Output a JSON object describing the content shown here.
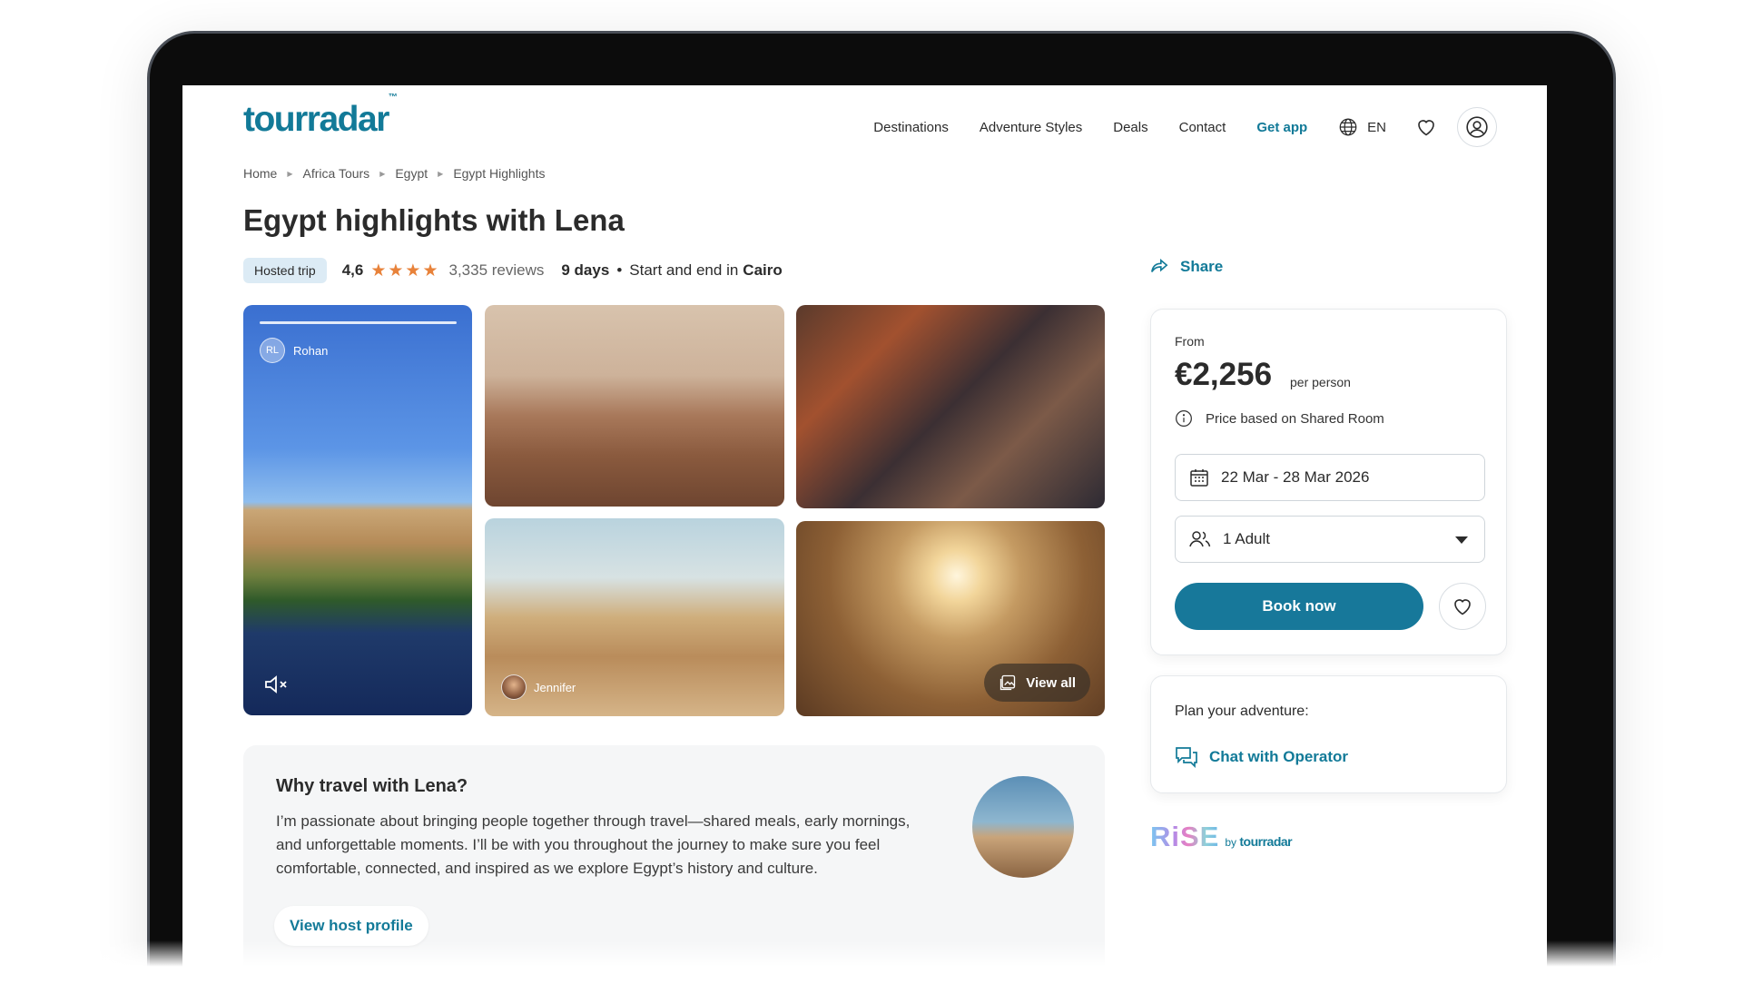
{
  "header": {
    "logo": "tourradar",
    "logo_tm": "™",
    "nav": [
      "Destinations",
      "Adventure Styles",
      "Deals",
      "Contact"
    ],
    "get_app": "Get app",
    "language": "EN"
  },
  "breadcrumb": [
    "Home",
    "Africa Tours",
    "Egypt",
    "Egypt Highlights"
  ],
  "tour": {
    "title": "Egypt highlights with Lena",
    "badge": "Hosted trip",
    "rating": "4,6",
    "stars": "★★★★",
    "reviews": "3,335 reviews",
    "days": "9 days",
    "start_end_prefix": "Start and end in",
    "city": "Cairo",
    "share": "Share"
  },
  "gallery": {
    "video_host_initials": "RL",
    "video_host_name": "Rohan",
    "photo_host_name": "Jennifer",
    "view_all": "View all"
  },
  "why": {
    "title": "Why travel with Lena?",
    "text": "I’m passionate about bringing people together through travel—shared meals, early mornings, and unforgettable moments. I’ll be with you throughout the journey to make sure you feel comfortable, connected, and inspired as we explore Egypt’s history and culture.",
    "button": "View host profile"
  },
  "booking": {
    "from_label": "From",
    "price": "€2,256",
    "per_person": "per person",
    "price_note": "Price based on Shared Room",
    "dates": "22 Mar - 28 Mar 2026",
    "travellers": "1 Adult",
    "book_button": "Book now"
  },
  "plan": {
    "label": "Plan your adventure:",
    "chat": "Chat with Operator"
  },
  "rise": {
    "word": "RiSE",
    "by": "by",
    "brand": "tourradar"
  },
  "colors": {
    "brand": "#127a98",
    "primary_button": "#17789a",
    "star": "#e8823a",
    "badge_bg": "#dcebf5"
  }
}
